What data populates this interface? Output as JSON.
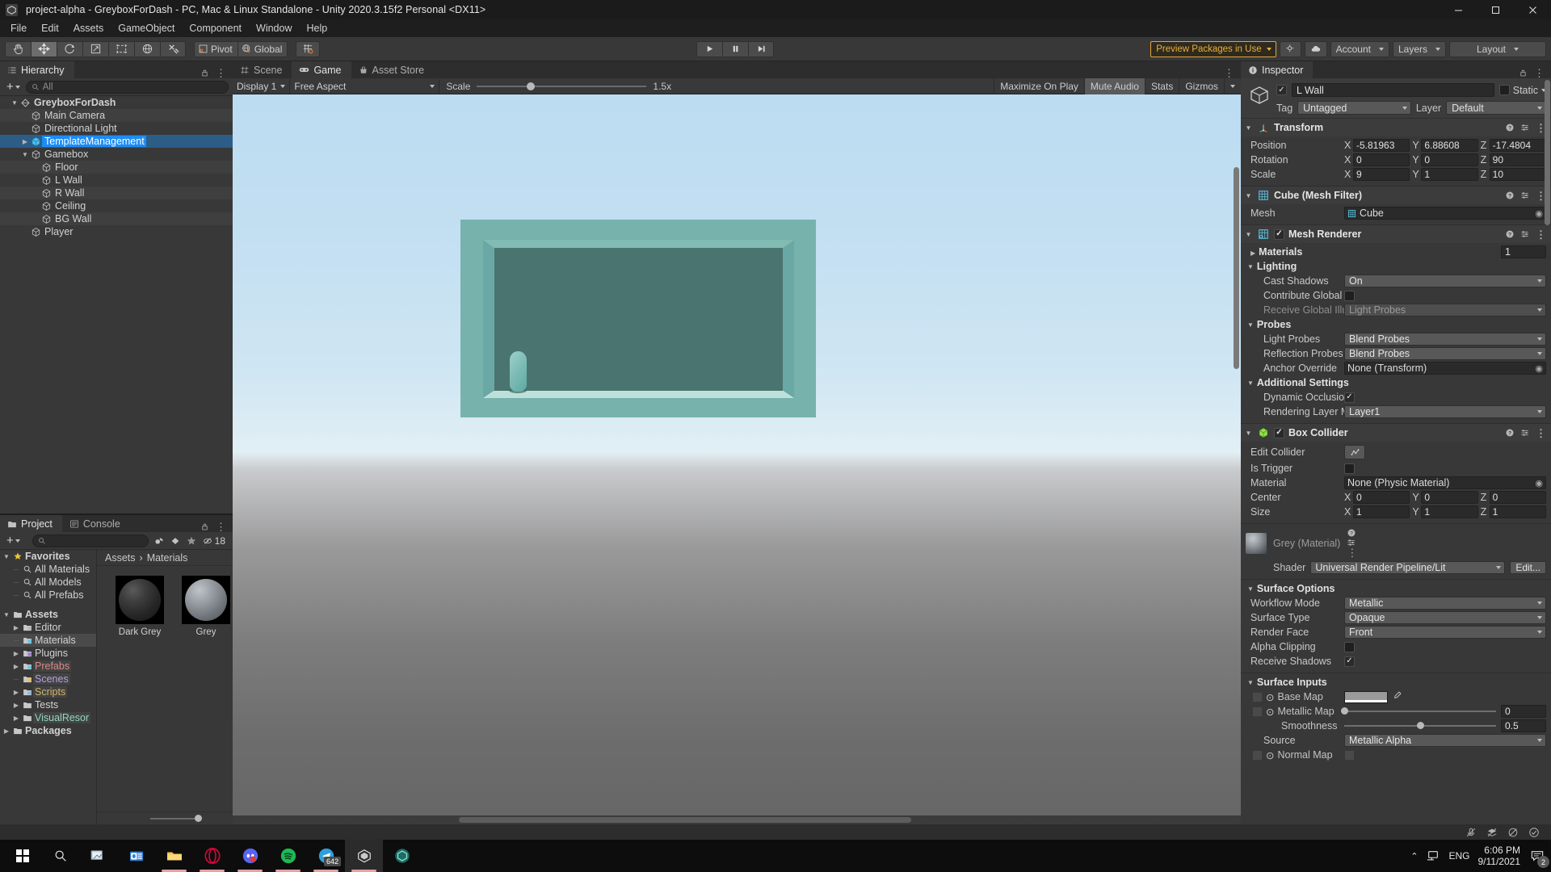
{
  "window": {
    "title": "project-alpha - GreyboxForDash - PC, Mac & Linux Standalone - Unity 2020.3.15f2 Personal <DX11>",
    "minimize": "─",
    "maximize": "☐",
    "close": "✕",
    "app_icon": "unity-icon"
  },
  "menubar": {
    "items": [
      "File",
      "Edit",
      "Assets",
      "GameObject",
      "Component",
      "Window",
      "Help"
    ]
  },
  "toolbar": {
    "tools": [
      {
        "name": "hand-tool",
        "active": false
      },
      {
        "name": "move-tool",
        "active": true
      },
      {
        "name": "rotate-tool",
        "active": false
      },
      {
        "name": "scale-tool",
        "active": false
      },
      {
        "name": "rect-tool",
        "active": false
      },
      {
        "name": "transform-tool",
        "active": false
      },
      {
        "name": "custom-tool",
        "active": false
      }
    ],
    "pivot_label": "Pivot",
    "global_label": "Global",
    "grid_snap": "grid-snap-icon",
    "play": "▶",
    "pause": "‖",
    "step": "⏭",
    "preview_packages": "Preview Packages in Use",
    "collab_icon": "cloud-icon",
    "search_icon": "search-icon",
    "account": "Account",
    "layers": "Layers",
    "layout": "Layout"
  },
  "hierarchy": {
    "tab": "Hierarchy",
    "search_placeholder": "All",
    "rows": [
      {
        "label": "GreyboxForDash",
        "depth": 0,
        "icon": "scene-icon",
        "twisty": "open",
        "selected": false
      },
      {
        "label": "Main Camera",
        "depth": 1,
        "icon": "gameobject-icon",
        "twisty": "",
        "selected": false
      },
      {
        "label": "Directional Light",
        "depth": 1,
        "icon": "gameobject-icon",
        "twisty": "",
        "selected": false
      },
      {
        "label": "TemplateManagement",
        "depth": 1,
        "icon": "prefab-icon",
        "twisty": "closed",
        "selected": true
      },
      {
        "label": "Gamebox",
        "depth": 1,
        "icon": "gameobject-icon",
        "twisty": "open",
        "selected": false
      },
      {
        "label": "Floor",
        "depth": 2,
        "icon": "gameobject-icon",
        "twisty": "",
        "selected": false
      },
      {
        "label": "L Wall",
        "depth": 2,
        "icon": "gameobject-icon",
        "twisty": "",
        "selected": false
      },
      {
        "label": "R Wall",
        "depth": 2,
        "icon": "gameobject-icon",
        "twisty": "",
        "selected": false
      },
      {
        "label": "Ceiling",
        "depth": 2,
        "icon": "gameobject-icon",
        "twisty": "",
        "selected": false
      },
      {
        "label": "BG Wall",
        "depth": 2,
        "icon": "gameobject-icon",
        "twisty": "",
        "selected": false
      },
      {
        "label": "Player",
        "depth": 1,
        "icon": "gameobject-icon",
        "twisty": "",
        "selected": false
      }
    ]
  },
  "gameview": {
    "tabs": [
      {
        "label": "Scene",
        "icon": "scene-tab-icon",
        "active": false
      },
      {
        "label": "Game",
        "icon": "game-tab-icon",
        "active": true
      },
      {
        "label": "Asset Store",
        "icon": "store-tab-icon",
        "active": false
      }
    ],
    "display": "Display 1",
    "aspect": "Free Aspect",
    "scale_label": "Scale",
    "scale_value": "1.5x",
    "maximize_on_play": "Maximize On Play",
    "mute_audio": "Mute Audio",
    "stats": "Stats",
    "gizmos": "Gizmos"
  },
  "project": {
    "tabs": [
      {
        "label": "Project",
        "icon": "project-tab-icon",
        "active": true
      },
      {
        "label": "Console",
        "icon": "console-tab-icon",
        "active": false
      }
    ],
    "search_placeholder": "",
    "visible_count": "18",
    "tree": [
      {
        "label": "Favorites",
        "depth": 0,
        "icon": "star-icon",
        "twisty": "open",
        "sel": false,
        "color": ""
      },
      {
        "label": "All Materials",
        "depth": 1,
        "icon": "search-icon",
        "twisty": "",
        "sel": false,
        "color": ""
      },
      {
        "label": "All Models",
        "depth": 1,
        "icon": "search-icon",
        "twisty": "",
        "sel": false,
        "color": ""
      },
      {
        "label": "All Prefabs",
        "depth": 1,
        "icon": "search-icon",
        "twisty": "",
        "sel": false,
        "color": ""
      },
      {
        "label": "",
        "depth": 0,
        "icon": "spacer",
        "twisty": "",
        "sel": false,
        "color": ""
      },
      {
        "label": "Assets",
        "depth": 0,
        "icon": "folder-icon",
        "twisty": "open",
        "sel": false,
        "color": ""
      },
      {
        "label": "Editor",
        "depth": 1,
        "icon": "folder-icon",
        "twisty": "closed",
        "sel": false,
        "color": ""
      },
      {
        "label": "Materials",
        "depth": 1,
        "icon": "folder-icon",
        "twisty": "",
        "sel": true,
        "color": ""
      },
      {
        "label": "Plugins",
        "depth": 1,
        "icon": "folder-icon",
        "twisty": "closed",
        "sel": false,
        "color": ""
      },
      {
        "label": "Prefabs",
        "depth": 1,
        "icon": "folder-icon",
        "twisty": "closed",
        "sel": false,
        "color": "#d98a8a"
      },
      {
        "label": "Scenes",
        "depth": 1,
        "icon": "folder-icon",
        "twisty": "",
        "sel": false,
        "color": "#b7a0e0"
      },
      {
        "label": "Scripts",
        "depth": 1,
        "icon": "folder-icon",
        "twisty": "closed",
        "sel": false,
        "color": "#d3b56a"
      },
      {
        "label": "Tests",
        "depth": 1,
        "icon": "folder-icon",
        "twisty": "closed",
        "sel": false,
        "color": ""
      },
      {
        "label": "VisualResor",
        "depth": 1,
        "icon": "folder-icon",
        "twisty": "closed",
        "sel": false,
        "color": "#8fd6c4"
      },
      {
        "label": "Packages",
        "depth": 0,
        "icon": "folder-icon",
        "twisty": "closed",
        "sel": false,
        "color": ""
      }
    ],
    "breadcrumb": [
      "Assets",
      "Materials"
    ],
    "assets": [
      {
        "name": "Dark Grey",
        "thumb": "sphere-dark"
      },
      {
        "name": "Grey",
        "thumb": "sphere-grey"
      }
    ]
  },
  "inspector": {
    "tab": "Inspector",
    "object_name": "L Wall",
    "enabled": true,
    "static_label": "Static",
    "tag_label": "Tag",
    "tag_value": "Untagged",
    "layer_label": "Layer",
    "layer_value": "Default",
    "components": [
      {
        "title": "Transform",
        "icon": "transform-icon",
        "rows": [
          {
            "label": "Position",
            "type": "vec3",
            "x": "-5.81963",
            "y": "6.88608",
            "z": "-17.4804"
          },
          {
            "label": "Rotation",
            "type": "vec3",
            "x": "0",
            "y": "0",
            "z": "90"
          },
          {
            "label": "Scale",
            "type": "vec3",
            "x": "9",
            "y": "1",
            "z": "10"
          }
        ]
      },
      {
        "title": "Cube (Mesh Filter)",
        "icon": "mesh-filter-icon",
        "rows": [
          {
            "label": "Mesh",
            "type": "object",
            "value": "Cube"
          }
        ]
      },
      {
        "title": "Mesh Renderer",
        "icon": "mesh-renderer-icon",
        "checkbox": true,
        "rows": [
          {
            "label": "Materials",
            "type": "foldout-count",
            "value": "1"
          },
          {
            "label": "Lighting",
            "type": "group"
          },
          {
            "label": "Cast Shadows",
            "type": "dropdown",
            "value": "On",
            "indent": true
          },
          {
            "label": "Contribute Global Illu",
            "type": "checkbox",
            "value": false,
            "indent": true
          },
          {
            "label": "Receive Global Illumi",
            "type": "dropdown",
            "value": "Light Probes",
            "indent": true,
            "dim": true
          },
          {
            "label": "Probes",
            "type": "group"
          },
          {
            "label": "Light Probes",
            "type": "dropdown",
            "value": "Blend Probes",
            "indent": true
          },
          {
            "label": "Reflection Probes",
            "type": "dropdown",
            "value": "Blend Probes",
            "indent": true
          },
          {
            "label": "Anchor Override",
            "type": "object",
            "value": "None (Transform)",
            "indent": true
          },
          {
            "label": "Additional Settings",
            "type": "group"
          },
          {
            "label": "Dynamic Occlusion",
            "type": "checkbox",
            "value": true,
            "indent": true
          },
          {
            "label": "Rendering Layer Mas",
            "type": "dropdown",
            "value": "Layer1",
            "indent": true
          }
        ]
      },
      {
        "title": "Box Collider",
        "icon": "box-collider-icon",
        "checkbox": true,
        "rows": [
          {
            "label": "Edit Collider",
            "type": "edit-collider"
          },
          {
            "label": "Is Trigger",
            "type": "checkbox",
            "value": false
          },
          {
            "label": "Material",
            "type": "object",
            "value": "None (Physic Material)"
          },
          {
            "label": "Center",
            "type": "vec3",
            "x": "0",
            "y": "0",
            "z": "0"
          },
          {
            "label": "Size",
            "type": "vec3",
            "x": "1",
            "y": "1",
            "z": "1"
          }
        ]
      }
    ],
    "material": {
      "title": "Grey (Material)",
      "shader_label": "Shader",
      "shader_value": "Universal Render Pipeline/Lit",
      "edit_button": "Edit...",
      "sections": [
        {
          "title": "Surface Options",
          "rows": [
            {
              "label": "Workflow Mode",
              "type": "dropdown",
              "value": "Metallic"
            },
            {
              "label": "Surface Type",
              "type": "dropdown",
              "value": "Opaque"
            },
            {
              "label": "Render Face",
              "type": "dropdown",
              "value": "Front"
            },
            {
              "label": "Alpha Clipping",
              "type": "checkbox",
              "value": false
            },
            {
              "label": "Receive Shadows",
              "type": "checkbox",
              "value": true
            }
          ]
        },
        {
          "title": "Surface Inputs",
          "rows": [
            {
              "label": "Base Map",
              "type": "color"
            },
            {
              "label": "Metallic Map",
              "type": "slider",
              "value": "0",
              "pos": 0
            },
            {
              "label": "Smoothness",
              "type": "slider",
              "value": "0.5",
              "pos": 50,
              "indent": true
            },
            {
              "label": "Source",
              "type": "dropdown",
              "value": "Metallic Alpha",
              "indent": true
            },
            {
              "label": "Normal Map",
              "type": "texture"
            }
          ]
        }
      ]
    }
  },
  "taskbar": {
    "start": "windows-logo-icon",
    "items": [
      {
        "name": "search-icon",
        "glyph": "search"
      },
      {
        "name": "task-view-icon",
        "glyph": "taskview"
      },
      {
        "name": "outlook-icon",
        "glyph": "outlook"
      },
      {
        "name": "file-explorer-icon",
        "glyph": "explorer"
      },
      {
        "name": "opera-icon",
        "glyph": "opera"
      },
      {
        "name": "discord-icon",
        "glyph": "discord"
      },
      {
        "name": "spotify-icon",
        "glyph": "spotify"
      },
      {
        "name": "telegram-icon",
        "glyph": "telegram",
        "badge": "642"
      },
      {
        "name": "unity-icon",
        "glyph": "unity",
        "active": true
      },
      {
        "name": "unity-hub-icon",
        "glyph": "unityhub"
      }
    ],
    "tray": {
      "chevron": "∧",
      "network": "network-icon",
      "language": "ENG",
      "time": "6:06 PM",
      "date": "9/11/2021",
      "notification_count": "2"
    },
    "status_icons": [
      "mute-mic-icon",
      "layers-off-icon",
      "no-camera-icon",
      "check-circle-icon"
    ]
  }
}
